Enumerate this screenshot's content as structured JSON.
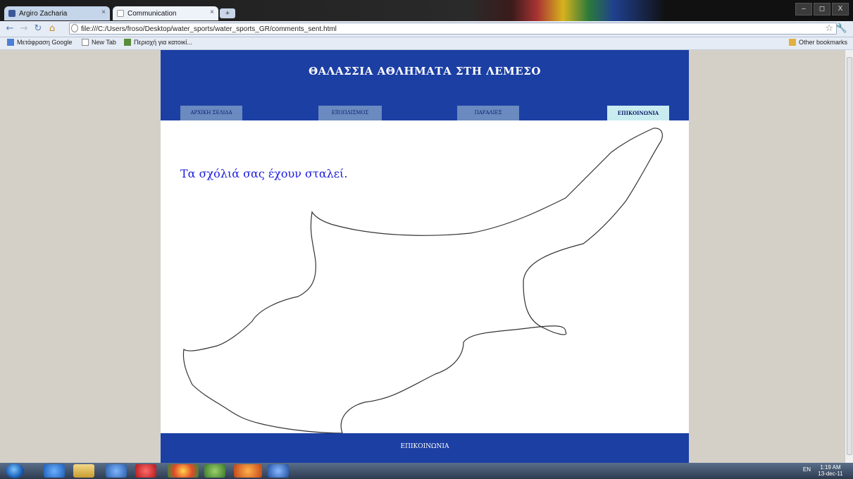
{
  "browser": {
    "tabs": [
      {
        "label": "Argiro Zacharia"
      },
      {
        "label": "Communication"
      }
    ],
    "new_tab_symbol": "+",
    "window_controls": [
      "–",
      "◻",
      "X"
    ],
    "address": "file:///C:/Users/froso/Desktop/water_sports/water_sports_GR/comments_sent.html",
    "bookmarks": [
      {
        "label": "Μετάφραση Google"
      },
      {
        "label": "New Tab"
      },
      {
        "label": "Περιοχή για κατοικί..."
      }
    ],
    "other_bookmarks": "Other bookmarks"
  },
  "site": {
    "title": "ΘΑΛΑΣΣΙΑ ΑΘΛΗΜΑΤΑ ΣΤΗ ΛΕΜΕΣΟ",
    "nav": [
      "ΑΡΧΙΚΗ ΣΕΛΙΔΑ",
      "ΕΞΟΠΛΙΣΜΟΣ",
      "ΠΑΡΑΛΙΕΣ",
      "ΕΠΙΚΟΙΝΩΝΙΑ"
    ],
    "active_nav": "ΕΠΙΚΟΙΝΩΝΙΑ",
    "message": "Τα σχόλιά σας έχουν σταλεί.",
    "footer": "ΕΠΙΚΟΙΝΩΝΙΑ"
  },
  "taskbar": {
    "tray_lang": "EN",
    "clock_time": "1:19 AM",
    "clock_date": "13-dec-11"
  },
  "colors": {
    "header_blue": "#1c3fa4",
    "nav_inactive": "#6a8ac0",
    "nav_active": "#c9ecf0",
    "message_text": "#1a1ae0"
  }
}
